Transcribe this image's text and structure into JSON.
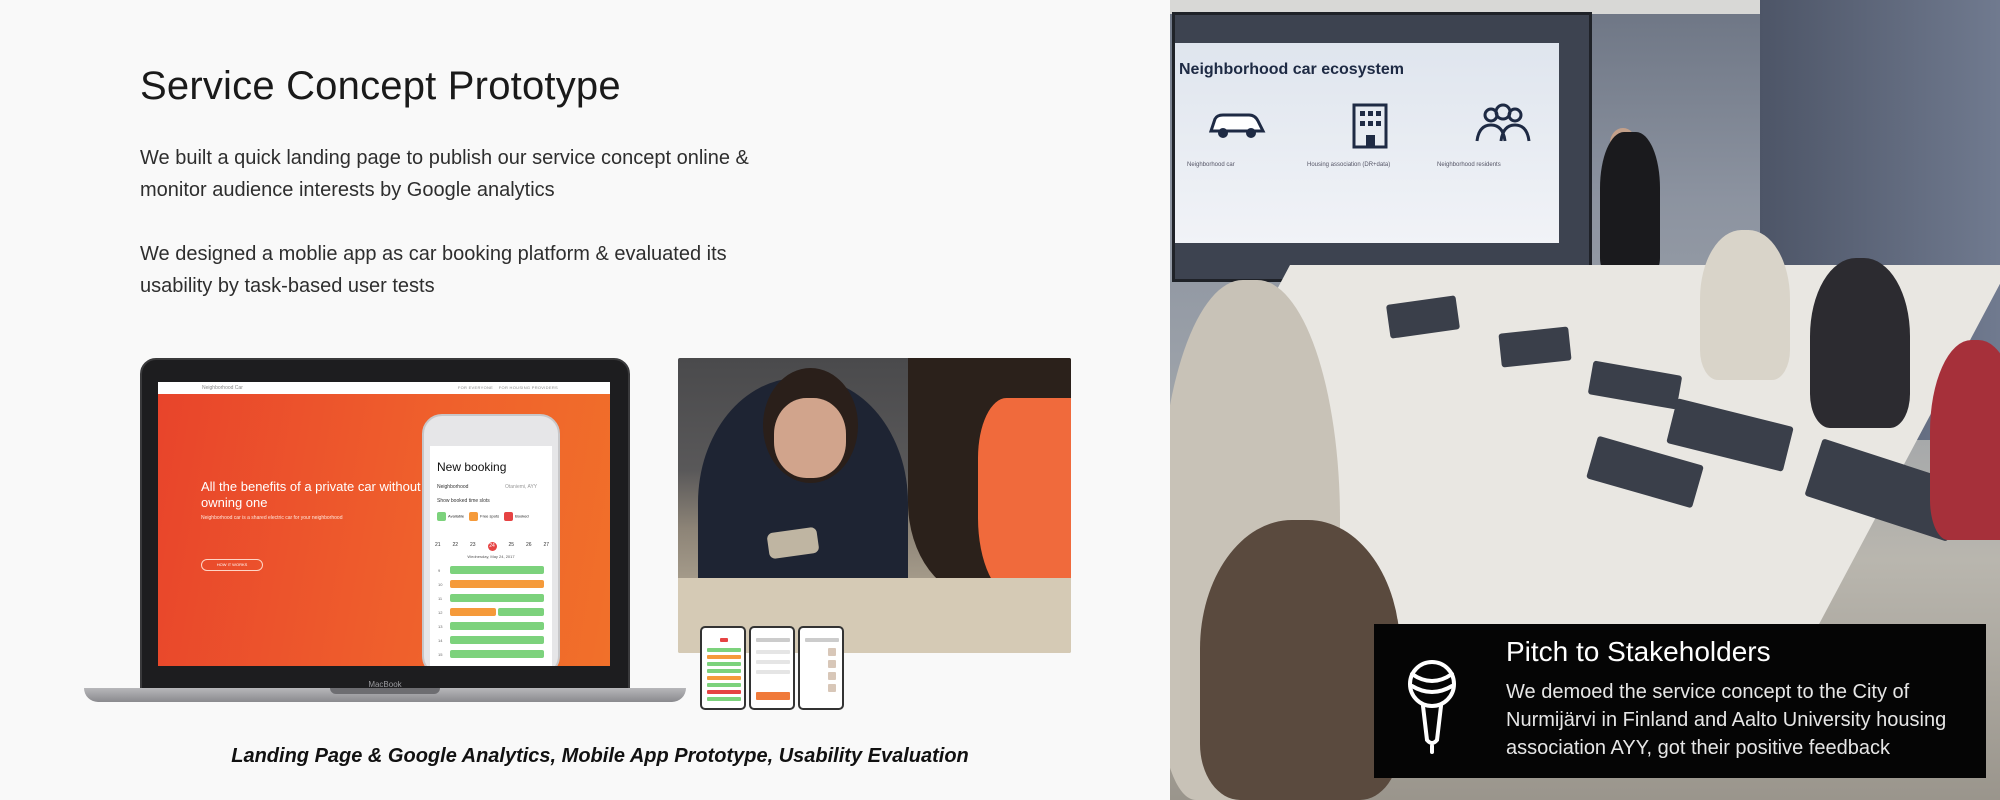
{
  "left": {
    "title": "Service Concept Prototype",
    "paragraph1": "We built a quick landing page to publish our service concept online & monitor audience interests by Google analytics",
    "paragraph2": "We designed a moblie app as car booking platform & evaluated its usability by task-based user tests",
    "caption": "Landing Page & Google Analytics, Mobile App Prototype, Usability Evaluation"
  },
  "laptop_screen": {
    "site_name": "Neighborhood Car",
    "nav_items": [
      "FOR EVERYONE",
      "FOR HOUSING PROVIDERS"
    ],
    "hero_heading": "All the benefits of a private car without owning one",
    "hero_sub": "Neighborhood car is a shared electric car for your neighborhood",
    "hero_button": "HOW IT WORKS",
    "brand": "MacBook",
    "phone": {
      "title": "New booking",
      "neighborhood_label": "Neighborhood",
      "neighborhood_value": "Otaniemi, AYY",
      "show_booked": "Show booked time slots",
      "legend": [
        "Available",
        "Free spots",
        "Booked"
      ],
      "dates": [
        "21",
        "22",
        "23",
        "24",
        "25",
        "26",
        "27"
      ],
      "selected_date": "24",
      "date_label": "Wednesday, May 24, 2017",
      "hours": [
        "9",
        "10",
        "11",
        "12",
        "13",
        "14",
        "15"
      ]
    }
  },
  "right": {
    "slide_title": "Neighborhood car ecosystem",
    "slide_cols": [
      "Neighborhood car",
      "Housing association (DR+data)",
      "Neighborhood residents"
    ],
    "caption_title": "Pitch to Stakeholders",
    "caption_text": "We demoed the service concept to the City of Nurmijärvi in Finland and Aalto University housing association AYY, got their positive feedback"
  },
  "colors": {
    "landing_orange": "#ec4e28",
    "available_green": "#7cd27c",
    "free_orange": "#f59a3a",
    "booked_red": "#e64343",
    "caption_bg": "#050505"
  },
  "icons": [
    "car-icon",
    "building-icon",
    "people-icon",
    "microphone-icon"
  ]
}
